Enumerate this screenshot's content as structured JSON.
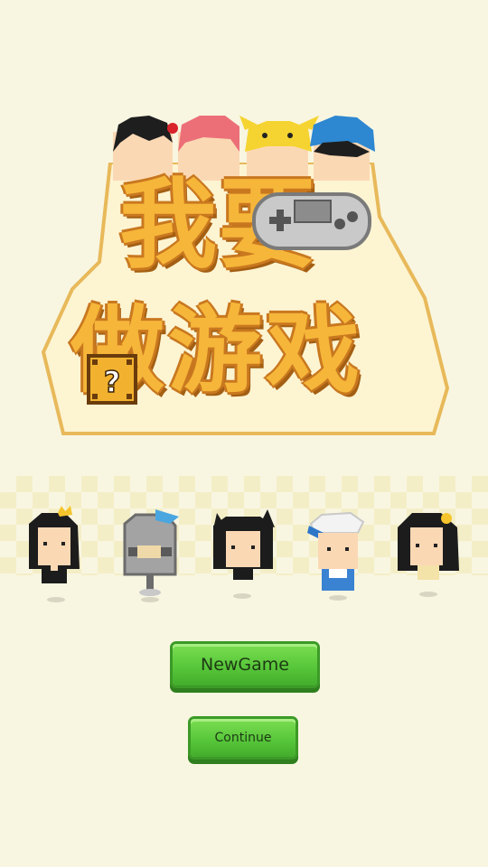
{
  "title": {
    "line1_char1": "我",
    "line1_char2": "要",
    "line2": "做游戏"
  },
  "menu": {
    "new_game_label": "NewGame",
    "continue_label": "Continue"
  },
  "characters": [
    {
      "name": "princess-girl-icon"
    },
    {
      "name": "knight-helmet-icon"
    },
    {
      "name": "cat-ear-girl-icon"
    },
    {
      "name": "cap-boy-icon"
    },
    {
      "name": "flower-girl-icon"
    }
  ],
  "colors": {
    "background": "#f8f6e1",
    "title_fill": "#f6b63a",
    "title_outline": "#c9781f",
    "button_green": "#58c73a"
  }
}
